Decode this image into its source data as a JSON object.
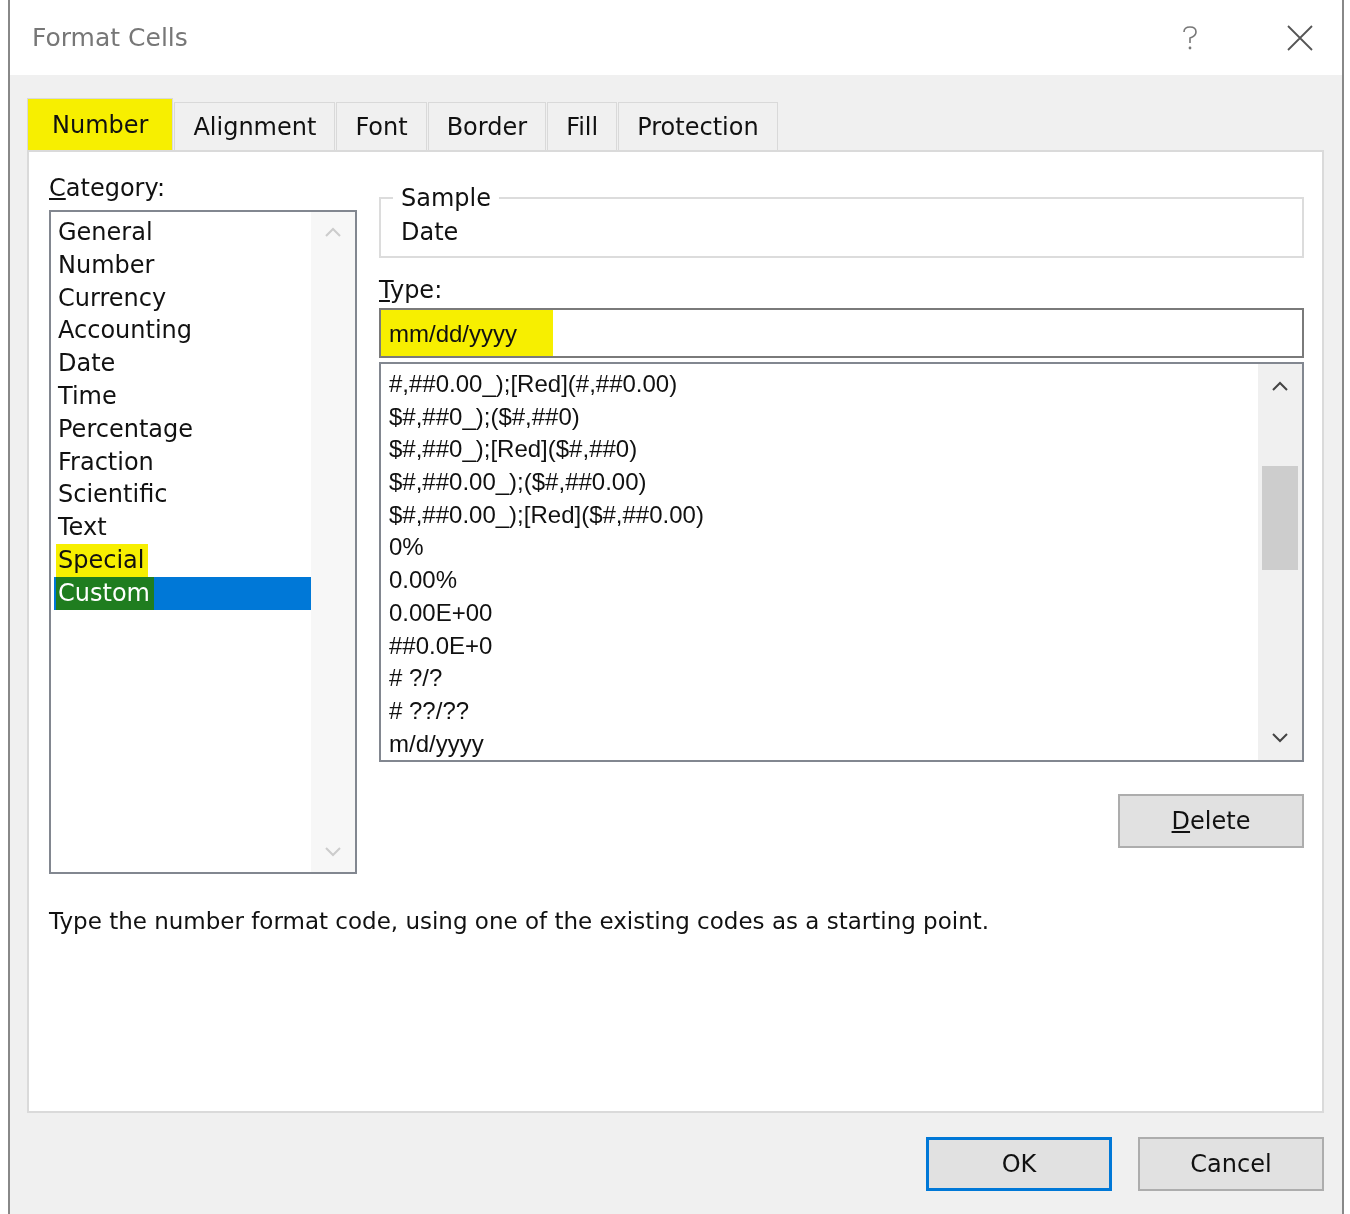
{
  "window": {
    "title": "Format Cells"
  },
  "tabs": [
    {
      "label": "Number",
      "selected": true,
      "highlighted": true
    },
    {
      "label": "Alignment",
      "selected": false,
      "highlighted": false
    },
    {
      "label": "Font",
      "selected": false,
      "highlighted": false
    },
    {
      "label": "Border",
      "selected": false,
      "highlighted": false
    },
    {
      "label": "Fill",
      "selected": false,
      "highlighted": false
    },
    {
      "label": "Protection",
      "selected": false,
      "highlighted": false
    }
  ],
  "category": {
    "label": "Category:",
    "items": [
      {
        "label": "General",
        "selected": false,
        "highlighted": false
      },
      {
        "label": "Number",
        "selected": false,
        "highlighted": false
      },
      {
        "label": "Currency",
        "selected": false,
        "highlighted": false
      },
      {
        "label": "Accounting",
        "selected": false,
        "highlighted": false
      },
      {
        "label": "Date",
        "selected": false,
        "highlighted": false
      },
      {
        "label": "Time",
        "selected": false,
        "highlighted": false
      },
      {
        "label": "Percentage",
        "selected": false,
        "highlighted": false
      },
      {
        "label": "Fraction",
        "selected": false,
        "highlighted": false
      },
      {
        "label": "Scientific",
        "selected": false,
        "highlighted": false
      },
      {
        "label": "Text",
        "selected": false,
        "highlighted": false
      },
      {
        "label": "Special",
        "selected": false,
        "highlighted": true
      },
      {
        "label": "Custom",
        "selected": true,
        "highlighted": true
      }
    ]
  },
  "sample": {
    "label": "Sample",
    "value": "Date"
  },
  "type": {
    "label": "Type:",
    "value": "mm/dd/yyyy",
    "highlighted": true
  },
  "format_codes": [
    "#,##0.00_);[Red](#,##0.00)",
    "$#,##0_);($#,##0)",
    "$#,##0_);[Red]($#,##0)",
    "$#,##0.00_);($#,##0.00)",
    "$#,##0.00_);[Red]($#,##0.00)",
    "0%",
    "0.00%",
    "0.00E+00",
    "##0.0E+0",
    "# ?/?",
    "# ??/??",
    "m/d/yyyy"
  ],
  "delete_button": "Delete",
  "description": "Type the number format code, using one of the existing codes as a starting point.",
  "buttons": [
    {
      "label": "OK",
      "default": true
    },
    {
      "label": "Cancel",
      "default": false
    }
  ]
}
